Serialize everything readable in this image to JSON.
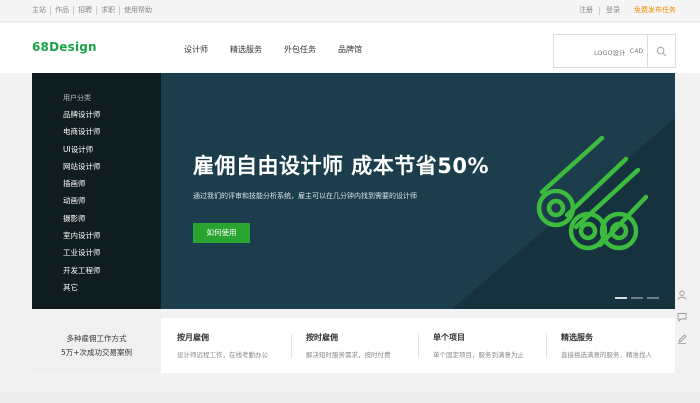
{
  "topbar": {
    "links": [
      "主站",
      "作品",
      "招聘",
      "求职",
      "使用帮助"
    ],
    "register": "注册",
    "login": "登录",
    "publish": "免费发布任务"
  },
  "header": {
    "logo": "68Design",
    "nav": [
      "设计师",
      "精选服务",
      "外包任务",
      "品牌馆"
    ],
    "search_hints": [
      "LOGO设计",
      "C4D"
    ]
  },
  "banner": {
    "sidebar_title": "用户分类",
    "categories": [
      "品牌设计师",
      "电商设计师",
      "UI设计师",
      "网站设计师",
      "插画师",
      "动画师",
      "摄影师",
      "室内设计师",
      "工业设计师",
      "开发工程师",
      "其它"
    ],
    "title": "雇佣自由设计师   成本节省50%",
    "subtitle": "通过我们的评审和技能分析系统，雇主可以在几分钟内找到需要的设计师",
    "cta": "如何使用"
  },
  "features": {
    "intro_line1": "多种雇佣工作方式",
    "intro_line2": "5万+次成功交易案例",
    "items": [
      {
        "title": "按月雇佣",
        "desc": "设计师远程工作，在线考勤办公"
      },
      {
        "title": "按时雇佣",
        "desc": "解决短时服务需求，按时付费"
      },
      {
        "title": "单个项目",
        "desc": "单个固定项目，服务到满意为止"
      },
      {
        "title": "精选服务",
        "desc": "直接挑选满意的服务，精准找人"
      }
    ]
  },
  "colors": {
    "brand_green": "#1aa349",
    "banner_bg": "#1c3d4b",
    "sidebar_bg": "#0f1c20",
    "cta_green": "#27a52f",
    "publish_orange": "#f08c00"
  },
  "icons": [
    "search-icon",
    "user-icon",
    "chat-icon",
    "edit-icon"
  ]
}
